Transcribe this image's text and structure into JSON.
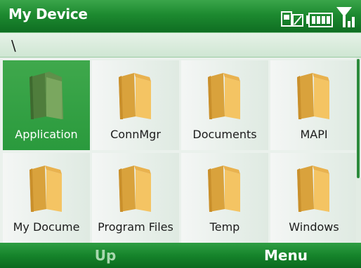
{
  "title_bar": {
    "title": "My Device",
    "status_icons": [
      "sim-phone-icon",
      "battery-icon",
      "signal-icon"
    ]
  },
  "path": {
    "text": "\\"
  },
  "folders": [
    {
      "name": "Application",
      "icon": "folder-icon",
      "selected": true
    },
    {
      "name": "ConnMgr",
      "icon": "folder-icon",
      "selected": false
    },
    {
      "name": "Documents",
      "icon": "folder-icon",
      "selected": false
    },
    {
      "name": "MAPI",
      "icon": "folder-icon",
      "selected": false
    },
    {
      "name": "My Docume",
      "icon": "folder-icon",
      "selected": false
    },
    {
      "name": "Program Files",
      "icon": "folder-icon",
      "selected": false
    },
    {
      "name": "Temp",
      "icon": "folder-icon",
      "selected": false
    },
    {
      "name": "Windows",
      "icon": "folder-icon",
      "selected": false
    }
  ],
  "softkeys": {
    "left": "Up",
    "right": "Menu"
  },
  "colors": {
    "accent": "#2a9a3d",
    "selected_folder": "#5f8f4a",
    "folder": "#f2c15c"
  }
}
